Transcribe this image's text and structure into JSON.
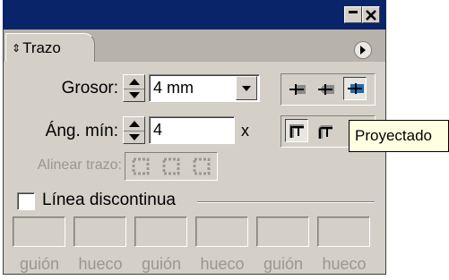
{
  "panel": {
    "tab_label": "Trazo"
  },
  "stroke": {
    "weight_label": "Grosor:",
    "weight_value": "4 mm",
    "miter_label": "Áng. mín:",
    "miter_value": "4",
    "miter_unit": "x",
    "align_label": "Alinear trazo:",
    "cap_selected": "projecting",
    "join_selected": "miter"
  },
  "dashed": {
    "checkbox_label": "Línea discontinua",
    "checked": false,
    "fields": [
      {
        "label": "guión",
        "value": ""
      },
      {
        "label": "hueco",
        "value": ""
      },
      {
        "label": "guión",
        "value": ""
      },
      {
        "label": "hueco",
        "value": ""
      },
      {
        "label": "guión",
        "value": ""
      },
      {
        "label": "hueco",
        "value": ""
      }
    ]
  },
  "tooltip": {
    "text": "Proyectado"
  },
  "icons": {
    "title_minimize": "minimize-icon",
    "title_close": "close-icon",
    "tab_collapse": "sort-arrows-icon",
    "panel_menu": "menu-arrow-icon"
  }
}
